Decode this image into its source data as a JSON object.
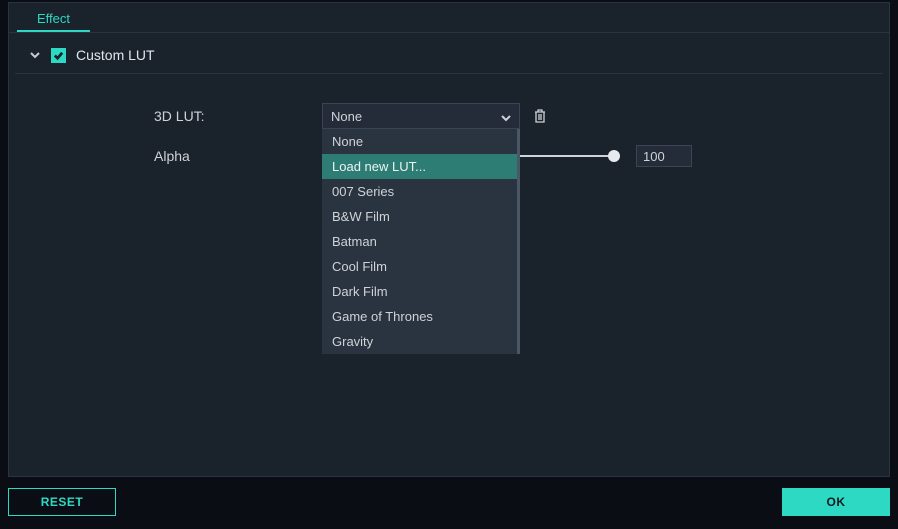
{
  "tab_label": "Effect",
  "section": {
    "title": "Custom LUT",
    "checked": true
  },
  "fields": {
    "lut_label": "3D LUT:",
    "lut_selected": "None",
    "alpha_label": "Alpha",
    "alpha_value": "100"
  },
  "dropdown": {
    "items": [
      "None",
      "Load new LUT...",
      "007 Series",
      "B&W Film",
      "Batman",
      "Cool Film",
      "Dark Film",
      "Game of Thrones",
      "Gravity"
    ],
    "hover_index": 1
  },
  "buttons": {
    "reset": "RESET",
    "ok": "OK"
  }
}
